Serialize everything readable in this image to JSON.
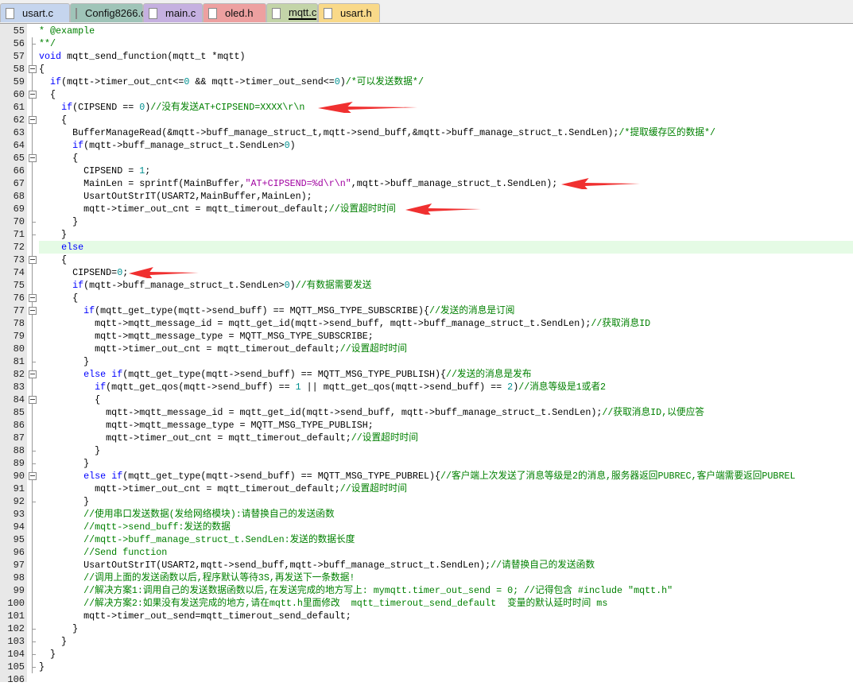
{
  "tabs": [
    {
      "label": "usart.c",
      "color": "#c5d5ee",
      "active": false
    },
    {
      "label": "Config8266.c",
      "color": "#9fc4b8",
      "active": false
    },
    {
      "label": "main.c",
      "color": "#c5b0e0",
      "active": false
    },
    {
      "label": "oled.h",
      "color": "#eda0a0",
      "active": false
    },
    {
      "label": "mqtt.c",
      "color": "#c3d4a8",
      "active": true
    },
    {
      "label": "usart.h",
      "color": "#f9d989",
      "active": false
    }
  ],
  "editor": {
    "first_line": 55,
    "highlighted_line": 72,
    "arrow_lines": [
      61,
      67,
      69,
      74
    ],
    "fold_lines": [
      58,
      60,
      62,
      65,
      73,
      76,
      77,
      82,
      84,
      90
    ],
    "lines": [
      "* @example",
      "**/",
      "void mqtt_send_function(mqtt_t *mqtt)",
      "{",
      "  if(mqtt->timer_out_cnt<=0 && mqtt->timer_out_send<=0)/*可以发送数据*/",
      "  {",
      "    if(CIPSEND == 0)//没有发送AT+CIPSEND=XXXX\\r\\n",
      "    {",
      "      BufferManageRead(&mqtt->buff_manage_struct_t,mqtt->send_buff,&mqtt->buff_manage_struct_t.SendLen);/*提取缓存区的数据*/",
      "      if(mqtt->buff_manage_struct_t.SendLen>0)",
      "      {",
      "        CIPSEND = 1;",
      "        MainLen = sprintf(MainBuffer,\"AT+CIPSEND=%d\\r\\n\",mqtt->buff_manage_struct_t.SendLen);",
      "        UsartOutStrIT(USART2,MainBuffer,MainLen);",
      "        mqtt->timer_out_cnt = mqtt_timerout_default;//设置超时时间",
      "      }",
      "    }",
      "    else",
      "    {",
      "      CIPSEND=0;",
      "      if(mqtt->buff_manage_struct_t.SendLen>0)//有数据需要发送",
      "      {",
      "        if(mqtt_get_type(mqtt->send_buff) == MQTT_MSG_TYPE_SUBSCRIBE){//发送的消息是订阅",
      "          mqtt->mqtt_message_id = mqtt_get_id(mqtt->send_buff, mqtt->buff_manage_struct_t.SendLen);//获取消息ID",
      "          mqtt->mqtt_message_type = MQTT_MSG_TYPE_SUBSCRIBE;",
      "          mqtt->timer_out_cnt = mqtt_timerout_default;//设置超时时间",
      "        }",
      "        else if(mqtt_get_type(mqtt->send_buff) == MQTT_MSG_TYPE_PUBLISH){//发送的消息是发布",
      "          if(mqtt_get_qos(mqtt->send_buff) == 1 || mqtt_get_qos(mqtt->send_buff) == 2)//消息等级是1或者2",
      "          {",
      "            mqtt->mqtt_message_id = mqtt_get_id(mqtt->send_buff, mqtt->buff_manage_struct_t.SendLen);//获取消息ID,以便应答",
      "            mqtt->mqtt_message_type = MQTT_MSG_TYPE_PUBLISH;",
      "            mqtt->timer_out_cnt = mqtt_timerout_default;//设置超时时间",
      "          }",
      "        }",
      "        else if(mqtt_get_type(mqtt->send_buff) == MQTT_MSG_TYPE_PUBREL){//客户端上次发送了消息等级是2的消息,服务器返回PUBREC,客户端需要返回PUBREL",
      "          mqtt->timer_out_cnt = mqtt_timerout_default;//设置超时时间",
      "        }",
      "        //使用串口发送数据(发给网络模块):请替换自己的发送函数",
      "        //mqtt->send_buff:发送的数据",
      "        //mqtt->buff_manage_struct_t.SendLen:发送的数据长度",
      "        //Send function",
      "        UsartOutStrIT(USART2,mqtt->send_buff,mqtt->buff_manage_struct_t.SendLen);//请替换自己的发送函数",
      "        //调用上面的发送函数以后,程序默认等待3S,再发送下一条数据!",
      "        //解决方案1:调用自己的发送数据函数以后,在发送完成的地方写上: mymqtt.timer_out_send = 0; //记得包含 #include \"mqtt.h\"",
      "        //解决方案2:如果没有发送完成的地方,请在mqtt.h里面修改  mqtt_timerout_send_default  变量的默认延时时间 ms",
      "        mqtt->timer_out_send=mqtt_timerout_send_default;",
      "      }",
      "    }",
      "  }",
      "}",
      ""
    ]
  },
  "colors": {
    "keyword": "#0000ff",
    "comment": "#008000",
    "number": "#009090",
    "string": "#a000a0",
    "arrow": "#f03030",
    "highlight": "#e5fbe5"
  }
}
